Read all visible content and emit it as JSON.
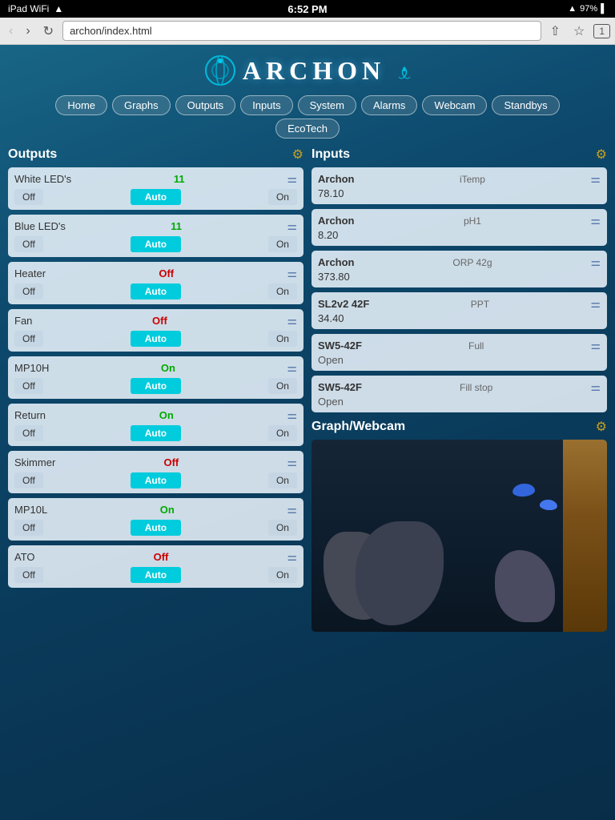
{
  "statusBar": {
    "left": "iPad WiFi",
    "time": "6:52 PM",
    "battery": "97%"
  },
  "browser": {
    "address": "archon/index.html",
    "tabCount": "1"
  },
  "logo": {
    "text": "ARCHON"
  },
  "nav": {
    "items": [
      "Home",
      "Graphs",
      "Outputs",
      "Inputs",
      "System",
      "Alarms",
      "Webcam",
      "Standbys"
    ],
    "row2": [
      "EcoTech"
    ]
  },
  "outputs": {
    "sectionTitle": "Outputs",
    "items": [
      {
        "label": "White LED's",
        "value": "11",
        "valueType": "number",
        "ctrl": [
          "Off",
          "Auto",
          "On"
        ]
      },
      {
        "label": "Blue LED's",
        "value": "11",
        "valueType": "number",
        "ctrl": [
          "Off",
          "Auto",
          "On"
        ]
      },
      {
        "label": "Heater",
        "value": "Off",
        "valueType": "off",
        "ctrl": [
          "Off",
          "Auto",
          "On"
        ]
      },
      {
        "label": "Fan",
        "value": "Off",
        "valueType": "off",
        "ctrl": [
          "Off",
          "Auto",
          "On"
        ]
      },
      {
        "label": "MP10H",
        "value": "On",
        "valueType": "on",
        "ctrl": [
          "Off",
          "Auto",
          "On"
        ]
      },
      {
        "label": "Return",
        "value": "On",
        "valueType": "on",
        "ctrl": [
          "Off",
          "Auto",
          "On"
        ]
      },
      {
        "label": "Skimmer",
        "value": "Off",
        "valueType": "off",
        "ctrl": [
          "Off",
          "Auto",
          "On"
        ]
      },
      {
        "label": "MP10L",
        "value": "On",
        "valueType": "on",
        "ctrl": [
          "Off",
          "Auto",
          "On"
        ]
      },
      {
        "label": "ATO",
        "value": "Off",
        "valueType": "off",
        "ctrl": [
          "Off",
          "Auto",
          "On"
        ]
      }
    ]
  },
  "inputs": {
    "sectionTitle": "Inputs",
    "items": [
      {
        "name": "Archon",
        "type": "iTemp",
        "value": "78.10",
        "isOpen": false
      },
      {
        "name": "Archon",
        "type": "pH1",
        "value": "8.20",
        "isOpen": false
      },
      {
        "name": "Archon",
        "type": "ORP 42g",
        "value": "373.80",
        "isOpen": false
      },
      {
        "name": "SL2v2 42F",
        "type": "PPT",
        "value": "34.40",
        "isOpen": false
      },
      {
        "name": "SW5-42F",
        "type": "Full",
        "value": "Open",
        "isOpen": true
      },
      {
        "name": "SW5-42F",
        "type": "Fill stop",
        "value": "Open",
        "isOpen": true
      }
    ]
  },
  "webcam": {
    "title": "Graph/Webcam"
  },
  "icons": {
    "gear": "⚙",
    "settings": "⚙",
    "back": "‹",
    "forward": "›",
    "reload": "↻",
    "share": "↑",
    "star": "☆",
    "signal": "▲",
    "wifi": "WiFi",
    "sliders": "⚌"
  }
}
